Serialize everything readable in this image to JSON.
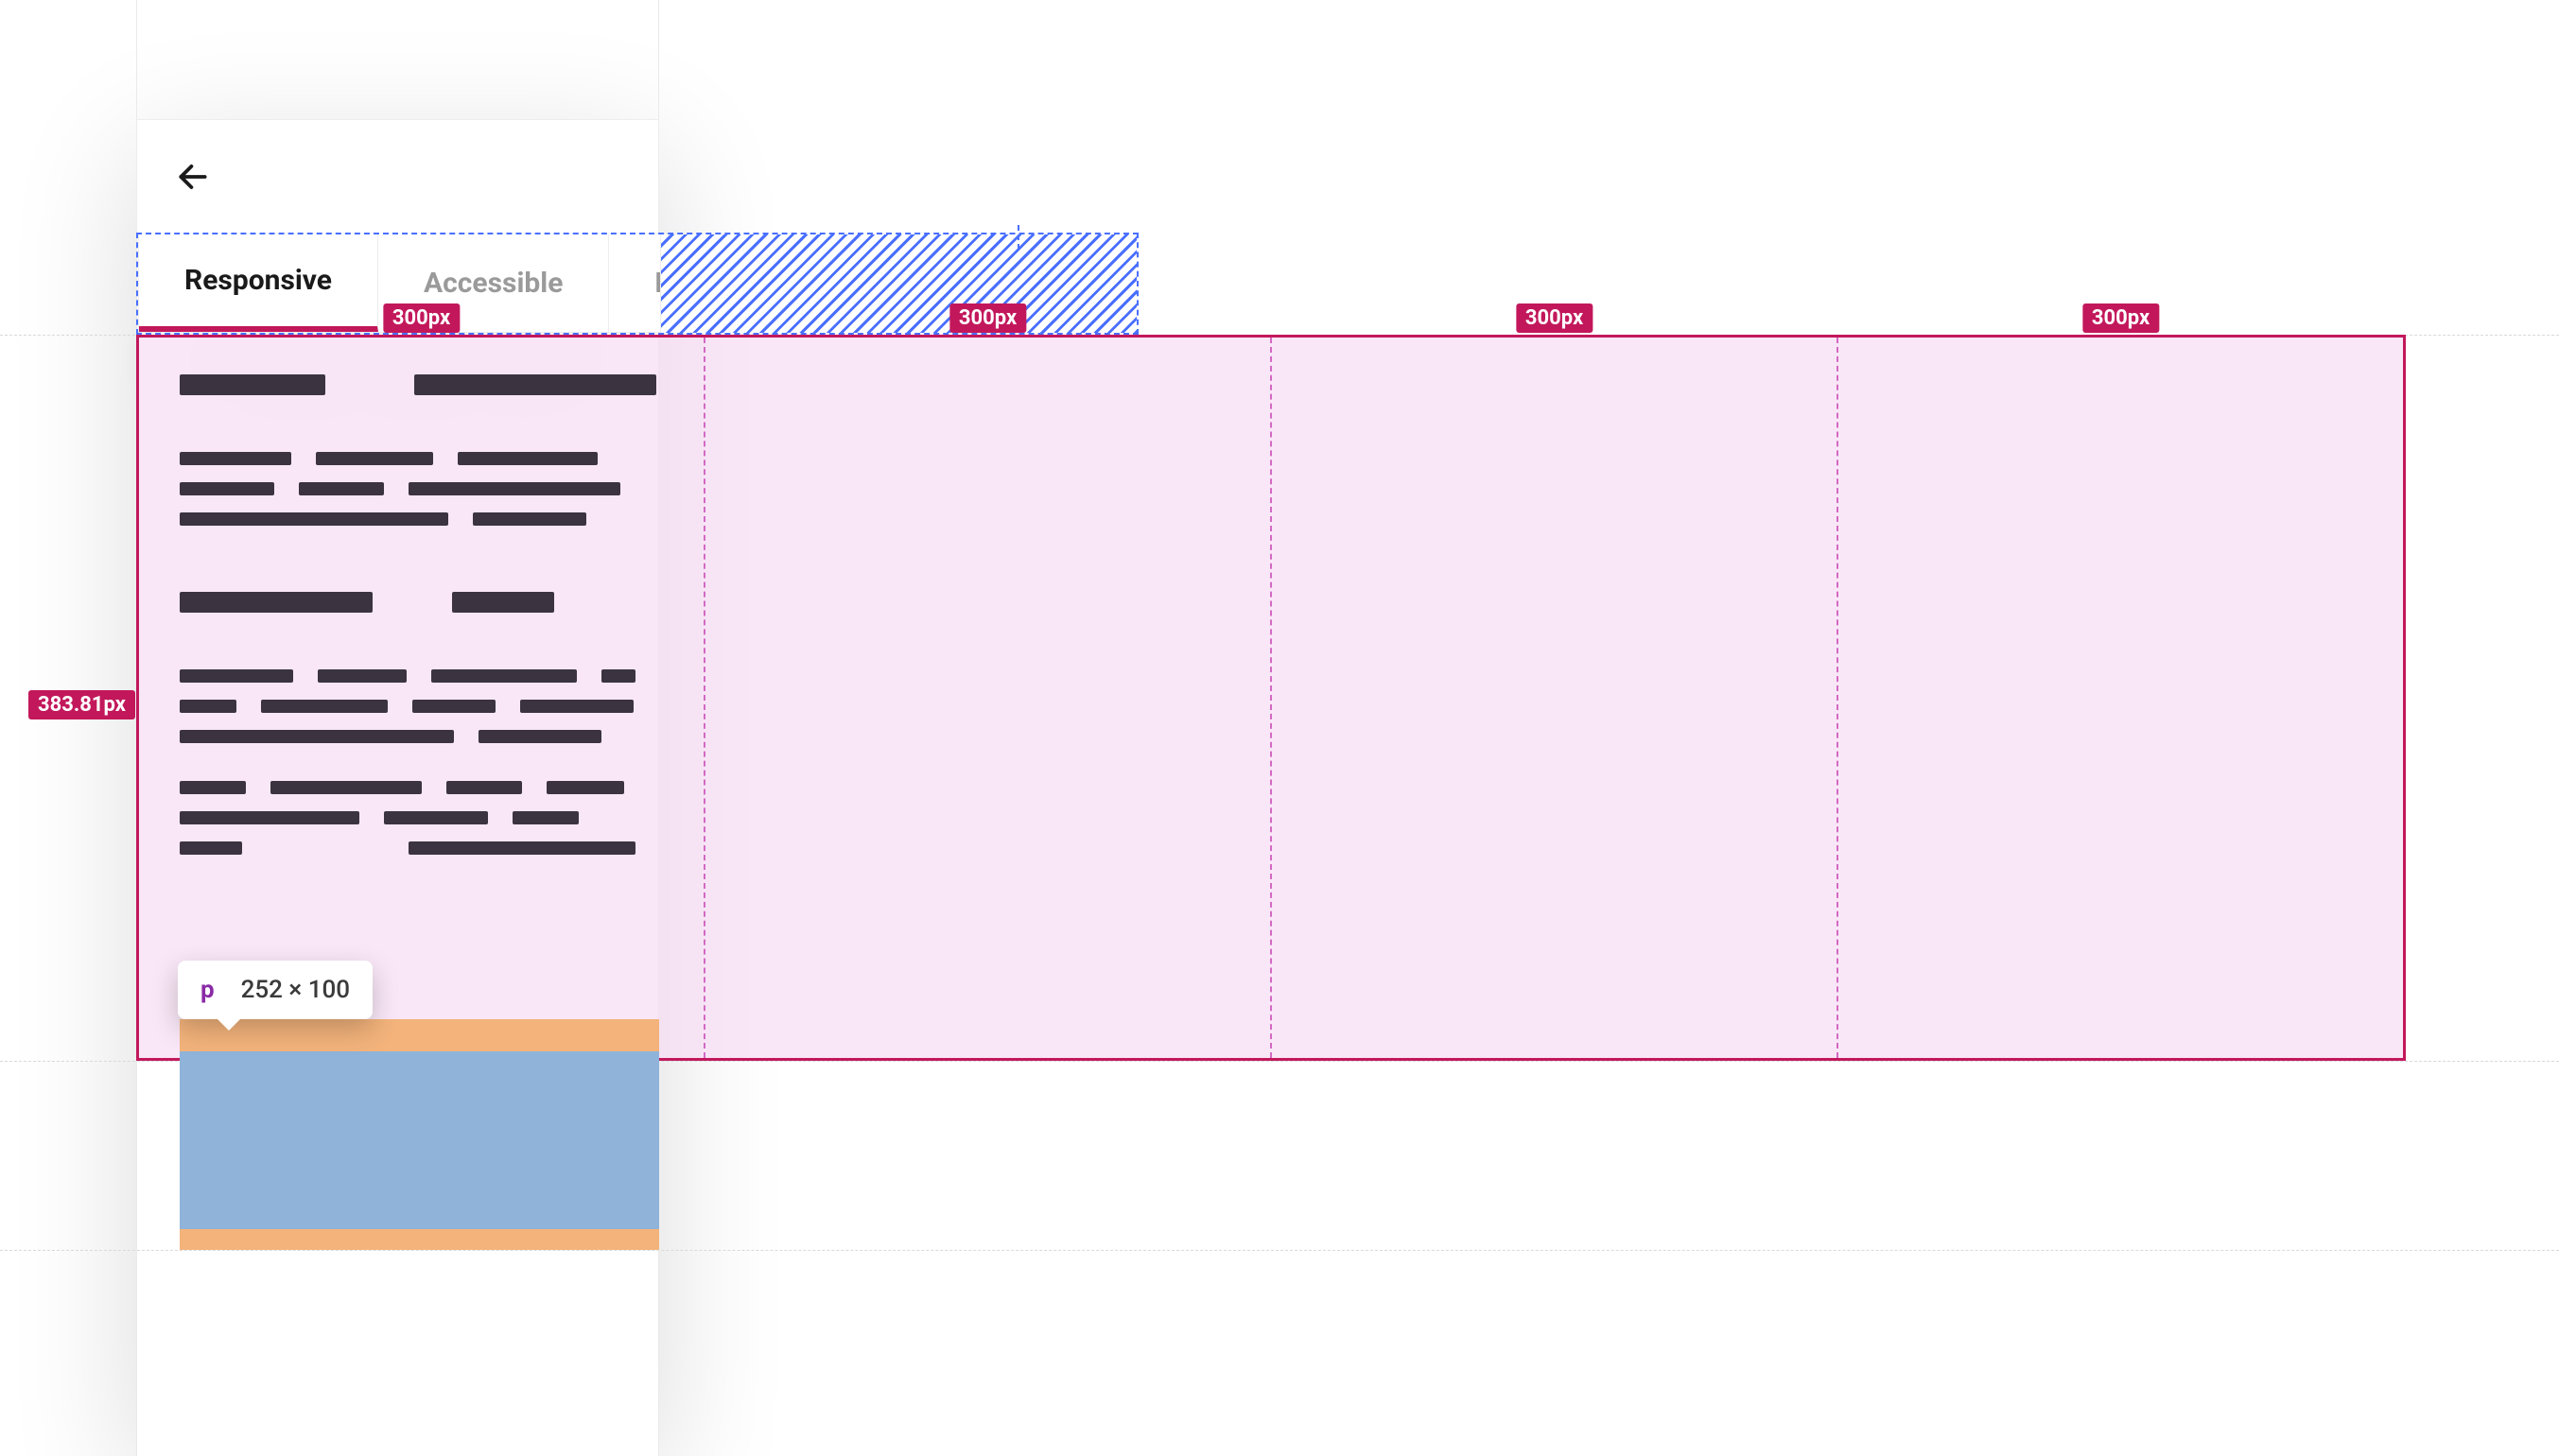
{
  "tabs": {
    "items": [
      "Responsive",
      "Accessible",
      "Horizontal"
    ],
    "activeIndex": 0
  },
  "columns": {
    "width_label": "300px",
    "count": 4
  },
  "container": {
    "height_label": "383.81px"
  },
  "tooltip": {
    "tag": "p",
    "dims": "252 × 100"
  },
  "colors": {
    "brand": "#c2185b",
    "hatch": "#4a6fff",
    "margin": "#f3b37b",
    "content": "#8fb3d9",
    "tint": "#f7ddf4"
  }
}
